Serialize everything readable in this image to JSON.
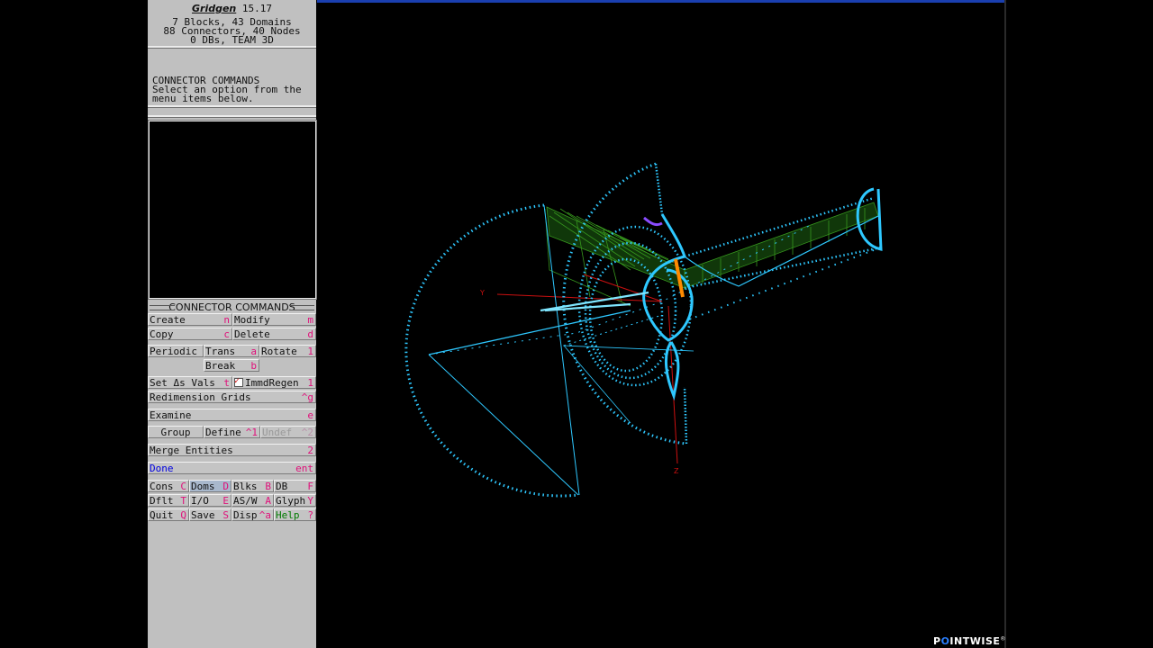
{
  "header": {
    "app_title": "Gridgen",
    "version": "15.17",
    "stats_line1": "7 Blocks, 43 Domains",
    "stats_line2": "88 Connectors, 40 Nodes",
    "stats_line3": "0 DBs, TEAM 3D"
  },
  "message": {
    "title": "CONNECTOR COMMANDS",
    "line1": "Select an option from the",
    "line2": "menu items below."
  },
  "menu": {
    "title": "CONNECTOR COMMANDS",
    "create": {
      "label": "Create",
      "key": "n"
    },
    "modify": {
      "label": "Modify",
      "key": "m"
    },
    "copy": {
      "label": "Copy",
      "key": "c"
    },
    "delete": {
      "label": "Delete",
      "key": "d"
    },
    "periodic": {
      "label": "Periodic"
    },
    "trans": {
      "label": "Trans",
      "key": "a"
    },
    "rotate": {
      "label": "Rotate",
      "key": "1"
    },
    "break": {
      "label": "Break",
      "key": "b"
    },
    "set_vals": {
      "label": "Set Δs Vals",
      "key": "t"
    },
    "immdregen": {
      "label": "ImmdRegen",
      "key": "1",
      "checked": true
    },
    "redimension": {
      "label": "Redimension Grids",
      "key": "^g"
    },
    "examine": {
      "label": "Examine",
      "key": "e"
    },
    "group": {
      "label": "Group"
    },
    "define": {
      "label": "Define",
      "key": "^1"
    },
    "undef": {
      "label": "Undef",
      "key": "^2"
    },
    "merge": {
      "label": "Merge Entities",
      "key": "2"
    },
    "done": {
      "label": "Done",
      "key": "ent"
    }
  },
  "bottom": {
    "cons": {
      "label": "Cons",
      "key": "C"
    },
    "doms": {
      "label": "Doms",
      "key": "D"
    },
    "blks": {
      "label": "Blks",
      "key": "B"
    },
    "db": {
      "label": "DB",
      "key": "F"
    },
    "dflt": {
      "label": "Dflt",
      "key": "T"
    },
    "io": {
      "label": "I/O",
      "key": "E"
    },
    "asw": {
      "label": "AS/W",
      "key": "A"
    },
    "glyph": {
      "label": "Glyph",
      "key": "Y"
    },
    "quit": {
      "label": "Quit",
      "key": "Q"
    },
    "save": {
      "label": "Save",
      "key": "S"
    },
    "disp": {
      "label": "Disp",
      "key": "^a"
    },
    "help": {
      "label": "Help",
      "key": "?"
    }
  },
  "viewport": {
    "axis_y_label": "Y",
    "axis_z_label": "Z",
    "colors": {
      "connector": "#2ec8ff",
      "domain_mesh": "#3aa020",
      "axis": "#cc1010",
      "highlight": "#ff8a00"
    }
  },
  "brand": {
    "prefix": "P",
    "o": "O",
    "suffix": "INTWISE",
    "reg": "®"
  }
}
